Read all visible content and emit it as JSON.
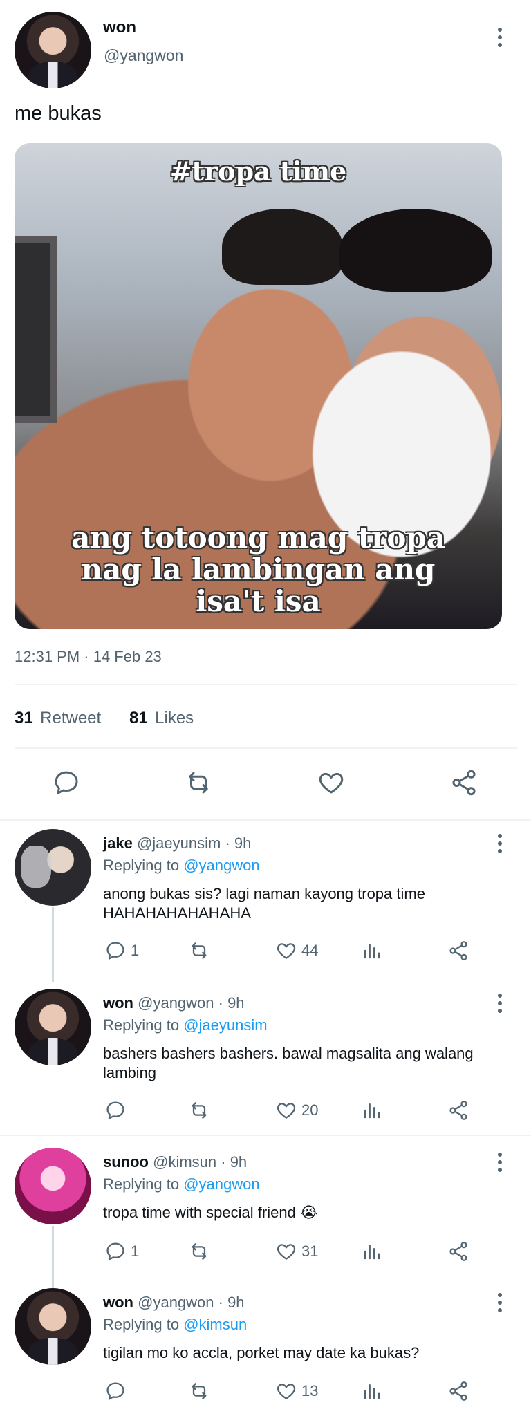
{
  "tweet": {
    "display_name": "won",
    "handle": "@yangwon",
    "text": "me bukas",
    "image": {
      "caption_top": "#tropa time",
      "caption_bottom_1": "ang totoong mag tropa",
      "caption_bottom_2": "nag la lambingan ang",
      "caption_bottom_3": "isa't isa"
    },
    "timestamp": "12:31 PM · 14 Feb 23",
    "retweets_count": "31",
    "retweets_label": "Retweet",
    "likes_count": "81",
    "likes_label": "Likes"
  },
  "replies": [
    {
      "name": "jake",
      "handle_time": "@jaeyunsim · 9h",
      "replying_label": "Replying to",
      "replying_to": "@yangwon",
      "text": "anong bukas sis? lagi naman kayong tropa time HAHAHAHAHAHAHA",
      "reply_count": "1",
      "like_count": "44"
    },
    {
      "name": "won",
      "handle_time": "@yangwon · 9h",
      "replying_label": "Replying to",
      "replying_to": "@jaeyunsim",
      "text": "bashers bashers bashers. bawal magsalita ang walang lambing",
      "reply_count": "",
      "like_count": "20"
    },
    {
      "name": "sunoo",
      "handle_time": "@kimsun · 9h",
      "replying_label": "Replying to",
      "replying_to": "@yangwon",
      "text": "tropa time with special friend 😭",
      "reply_count": "1",
      "like_count": "31"
    },
    {
      "name": "won",
      "handle_time": "@yangwon · 9h",
      "replying_label": "Replying to",
      "replying_to": "@kimsun",
      "text": "tigilan mo ko accla, porket may date ka bukas?",
      "reply_count": "",
      "like_count": "13"
    }
  ],
  "icons": {
    "reply": "reply-icon",
    "retweet": "retweet-icon",
    "like": "heart-icon",
    "analytics": "analytics-icon",
    "share": "share-icon",
    "more": "more-icon"
  },
  "colors": {
    "accent": "#1d9bf0",
    "text": "#0f1419",
    "muted": "#536471",
    "divider": "#eff3f4"
  }
}
